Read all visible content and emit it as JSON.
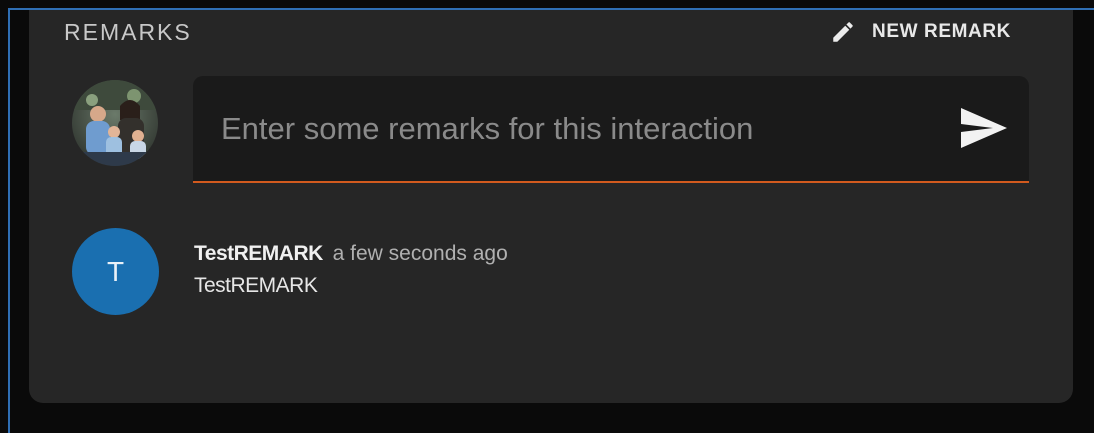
{
  "remarks_panel": {
    "title": "REMARKS",
    "new_remark_label": "NEW REMARK",
    "new_remark_icon": "pencil-icon",
    "input": {
      "placeholder": "Enter some remarks for this interaction",
      "value": ""
    },
    "send_icon": "send-icon",
    "current_user_avatar": "user-photo-avatar"
  },
  "remarks": [
    {
      "avatar_initial": "T",
      "author": "TestREMARK",
      "time": "a few seconds ago",
      "text": "TestREMARK"
    }
  ],
  "colors": {
    "card_bg": "#262626",
    "input_bg": "#1a1a1a",
    "input_underline": "#d25a1e",
    "avatar_bg": "#1a6fb0",
    "frame_border": "#2f6fb5"
  }
}
